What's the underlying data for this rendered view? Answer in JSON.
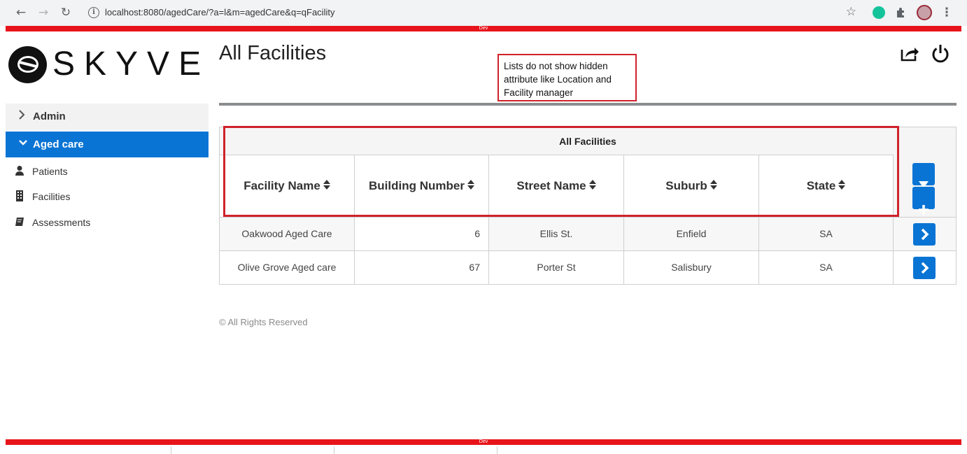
{
  "browser": {
    "url": "localhost:8080/agedCare/?a=l&m=agedCare&q=qFacility",
    "back_icon": "arrow-left-icon",
    "forward_icon": "arrow-right-icon",
    "reload_icon": "reload-icon"
  },
  "env": {
    "dev_label": "Dev"
  },
  "logo": {
    "text": "SKYVE"
  },
  "sidebar": {
    "groups": [
      {
        "label": "Admin",
        "expanded": false
      },
      {
        "label": "Aged care",
        "expanded": true
      }
    ],
    "items": [
      {
        "label": "Patients",
        "icon": "user-icon"
      },
      {
        "label": "Facilities",
        "icon": "building-icon"
      },
      {
        "label": "Assessments",
        "icon": "book-icon"
      }
    ]
  },
  "page": {
    "title": "All Facilities",
    "note": "Lists do not show hidden attribute like Location and Facility manager"
  },
  "grid": {
    "title": "All Facilities",
    "columns": [
      "Facility Name",
      "Building Number",
      "Street Name",
      "Suburb",
      "State"
    ],
    "rows": [
      [
        "Oakwood Aged Care",
        "6",
        "Ellis St.",
        "Enfield",
        "SA"
      ],
      [
        "Olive Grove Aged care",
        "67",
        "Porter St",
        "Salisbury",
        "SA"
      ]
    ]
  },
  "footer": {
    "text": "© All Rights Reserved"
  },
  "colors": {
    "accent": "#0a74d4",
    "dev_bar": "#e8141b",
    "highlight": "#d0222b"
  }
}
